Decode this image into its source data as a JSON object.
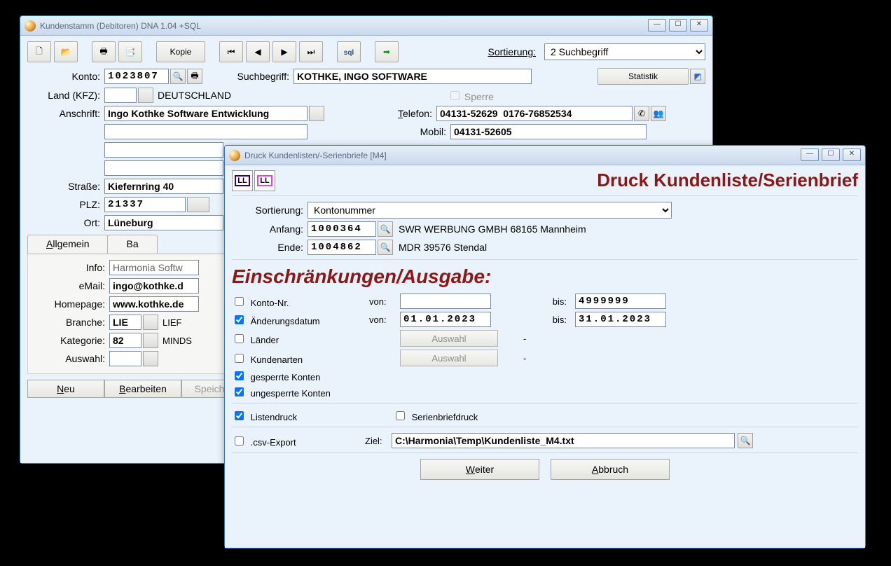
{
  "win1": {
    "title": "Kundenstamm (Debitoren) DNA 1.04 +SQL",
    "toolbar": {
      "kopie": "Kopie",
      "sort_label": "Sortierung:",
      "sort_value": "2 Suchbegriff"
    },
    "statistik": "Statistik",
    "labels": {
      "konto": "Konto:",
      "such": "Suchbegriff:",
      "landkfz": "Land (KFZ):",
      "anschrift": "Anschrift:",
      "strasse": "Straße:",
      "plz": "PLZ:",
      "ort": "Ort:",
      "sperre": "Sperre",
      "telefon": "Telefon:",
      "mobil": "Mobil:",
      "info": "Info:",
      "email": "eMail:",
      "homepage": "Homepage:",
      "branche": "Branche:",
      "kategorie": "Kategorie:",
      "auswahl": "Auswahl:"
    },
    "fields": {
      "konto": "1023807",
      "suchbegriff": "KOTHKE, INGO SOFTWARE",
      "land": "DEUTSCHLAND",
      "anschrift": "Ingo Kothke Software Entwicklung",
      "strasse": "Kiefernring 40",
      "plz": "21337",
      "ort": "Lüneburg",
      "telefon": "04131-52629  0176-76852534",
      "mobil": "04131-52605",
      "info": "Harmonia Softw",
      "email": "ingo@kothke.d",
      "homepage": "www.kothke.de",
      "branche_code": "LIE",
      "branche_text": "LIEF",
      "kategorie_code": "82",
      "kategorie_text": "MINDS"
    },
    "tabs": {
      "allgemein": "Allgemein",
      "ba": "Ba"
    },
    "btns": {
      "neu": "Neu",
      "bearbeiten": "Bearbeiten",
      "speichern": "Speich"
    }
  },
  "win2": {
    "title": "Druck Kundenlisten/-Serienbriefe [M4]",
    "heading": "Druck Kundenliste/Serienbrief",
    "subhead": "Einschränkungen/Ausgabe:",
    "labels": {
      "sortierung": "Sortierung:",
      "anfang": "Anfang:",
      "ende": "Ende:",
      "von": "von:",
      "bis": "bis:",
      "auswahl": "Auswahl",
      "ziel": "Ziel:",
      "weiter": "Weiter",
      "abbruch": "Abbruch"
    },
    "fields": {
      "sortierung": "Kontonummer",
      "anfang_konto": "1000364",
      "anfang_text": "SWR WERBUNG GMBH 68165 Mannheim",
      "ende_konto": "1004862",
      "ende_text": "MDR 39576 Stendal",
      "konto_bis": "4999999",
      "datum_von": "01.01.2023",
      "datum_bis": "31.01.2023",
      "ziel": "C:\\Harmonia\\Temp\\Kundenliste_M4.txt"
    },
    "checks": {
      "konto_nr": "Konto-Nr.",
      "aenderungsdatum": "Änderungsdatum",
      "laender": "Länder",
      "kundenarten": "Kundenarten",
      "gesperrte": "gesperrte Konten",
      "ungesperrte": "ungesperrte Konten",
      "listendruck": "Listendruck",
      "serienbrief": "Serienbriefdruck",
      "csv": ".csv-Export"
    },
    "dash": "-"
  }
}
